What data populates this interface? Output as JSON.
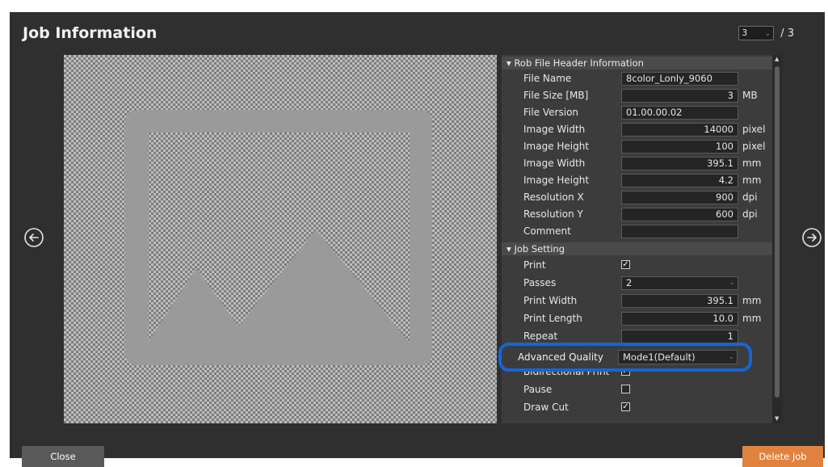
{
  "title": "Job Information",
  "pager": {
    "current": "3",
    "separator": "/ 3"
  },
  "sections": {
    "header_info": "Rob File Header Information",
    "job_setting": "Job Setting"
  },
  "header_rows": [
    {
      "label": "File Name",
      "value": "8color_Lonly_9060",
      "unit": ""
    },
    {
      "label": "File Size [MB]",
      "value": "3",
      "unit": "MB"
    },
    {
      "label": "File Version",
      "value": "01.00.00.02",
      "unit": ""
    },
    {
      "label": "Image Width",
      "value": "14000",
      "unit": "pixel"
    },
    {
      "label": "Image Height",
      "value": "100",
      "unit": "pixel"
    },
    {
      "label": "Image Width",
      "value": "395.1",
      "unit": "mm"
    },
    {
      "label": "Image Height",
      "value": "4.2",
      "unit": "mm"
    },
    {
      "label": "Resolution X",
      "value": "900",
      "unit": "dpi"
    },
    {
      "label": "Resolution Y",
      "value": "600",
      "unit": "dpi"
    },
    {
      "label": "Comment",
      "value": "",
      "unit": ""
    }
  ],
  "job_rows": {
    "print": {
      "label": "Print",
      "checked": true
    },
    "passes": {
      "label": "Passes",
      "value": "2"
    },
    "print_width": {
      "label": "Print Width",
      "value": "395.1",
      "unit": "mm"
    },
    "print_length": {
      "label": "Print Length",
      "value": "10.0",
      "unit": "mm"
    },
    "repeat": {
      "label": "Repeat",
      "value": "1"
    },
    "advanced_quality": {
      "label": "Advanced Quality",
      "value": "Mode1(Default)"
    },
    "bidirectional": {
      "label": "Bidirectional Print",
      "checked": true
    },
    "pause": {
      "label": "Pause",
      "checked": false
    },
    "draw_cut": {
      "label": "Draw Cut",
      "checked": true
    }
  },
  "icons": {
    "prev": "arrow-left-circle-icon",
    "next": "arrow-right-circle-icon",
    "placeholder": "image-placeholder-icon",
    "check": "✓"
  },
  "buttons": {
    "close": "Close",
    "delete": "Delete Job"
  },
  "colors": {
    "accent": "#e0823d",
    "highlight": "#1565d8",
    "background": "#2f2f2f"
  }
}
